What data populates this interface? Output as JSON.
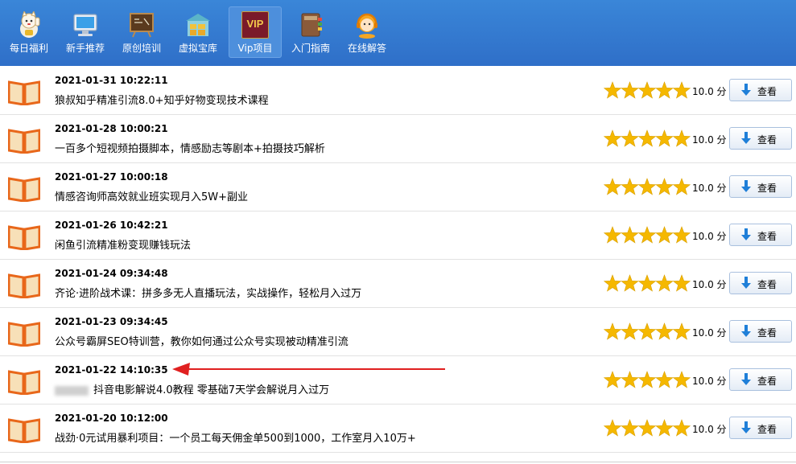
{
  "nav": [
    {
      "label": "每日福利",
      "icon": "lucky-cat-icon"
    },
    {
      "label": "新手推荐",
      "icon": "monitor-icon"
    },
    {
      "label": "原创培训",
      "icon": "blackboard-icon"
    },
    {
      "label": "虚拟宝库",
      "icon": "warehouse-icon"
    },
    {
      "label": "Vip项目",
      "icon": "vip-badge-icon",
      "active": true,
      "badge": "VIP"
    },
    {
      "label": "入门指南",
      "icon": "book-guide-icon"
    },
    {
      "label": "在线解答",
      "icon": "support-agent-icon"
    }
  ],
  "colors": {
    "accent": "#2f6fc8",
    "star": "#f5b800",
    "book": "#e8671a",
    "arrow": "#e02020"
  },
  "items": [
    {
      "date": "2021-01-31 10:22:11",
      "title": "狼叔知乎精准引流8.0+知乎好物变现技术课程",
      "rating": 5,
      "score": "10.0 分",
      "button": "查看"
    },
    {
      "date": "2021-01-28 10:00:21",
      "title": "一百多个短视频拍摄脚本，情感励志等剧本+拍摄技巧解析",
      "rating": 5,
      "score": "10.0 分",
      "button": "查看"
    },
    {
      "date": "2021-01-27 10:00:18",
      "title": "情感咨询师高效就业班实现月入5W+副业",
      "rating": 5,
      "score": "10.0 分",
      "button": "查看"
    },
    {
      "date": "2021-01-26 10:42:21",
      "title": "闲鱼引流精准粉变现赚钱玩法",
      "rating": 5,
      "score": "10.0 分",
      "button": "查看"
    },
    {
      "date": "2021-01-24 09:34:48",
      "title": "齐论·进阶战术课：拼多多无人直播玩法，实战操作，轻松月入过万",
      "rating": 5,
      "score": "10.0 分",
      "button": "查看"
    },
    {
      "date": "2021-01-23 09:34:45",
      "title": "公众号霸屏SEO特训营，教你如何通过公众号实现被动精准引流",
      "rating": 5,
      "score": "10.0 分",
      "button": "查看"
    },
    {
      "date": "2021-01-22 14:10:35",
      "title": "抖音电影解说4.0教程 零基础7天学会解说月入过万",
      "rating": 5,
      "score": "10.0 分",
      "button": "查看",
      "blurred_prefix": true
    },
    {
      "date": "2021-01-20 10:12:00",
      "title": "战劲·0元试用暴利项目：一个员工每天佣金单500到1000，工作室月入10万+",
      "rating": 5,
      "score": "10.0 分",
      "button": "查看"
    }
  ]
}
